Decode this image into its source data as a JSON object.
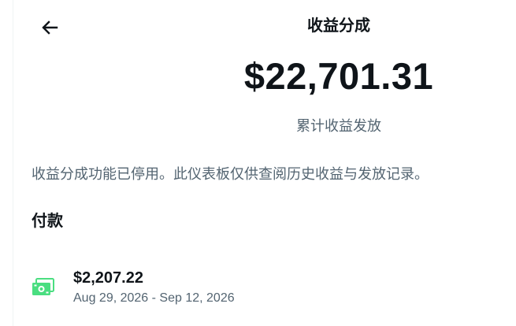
{
  "header": {
    "back_icon": "arrow-left-icon",
    "title": "收益分成"
  },
  "summary": {
    "total_amount": "$22,701.31",
    "caption": "累计收益发放"
  },
  "notice": "收益分成功能已停用。此仪表板仅供查阅历史收益与发放记录。",
  "payouts": {
    "heading": "付款",
    "items": [
      {
        "icon": "cash-icon",
        "amount": "$2,207.22",
        "period": "Aug 29, 2026 - Sep 12, 2026"
      }
    ]
  },
  "colors": {
    "text_primary": "#0f1419",
    "text_secondary": "#536471",
    "cash_icon": "#4ade80"
  }
}
